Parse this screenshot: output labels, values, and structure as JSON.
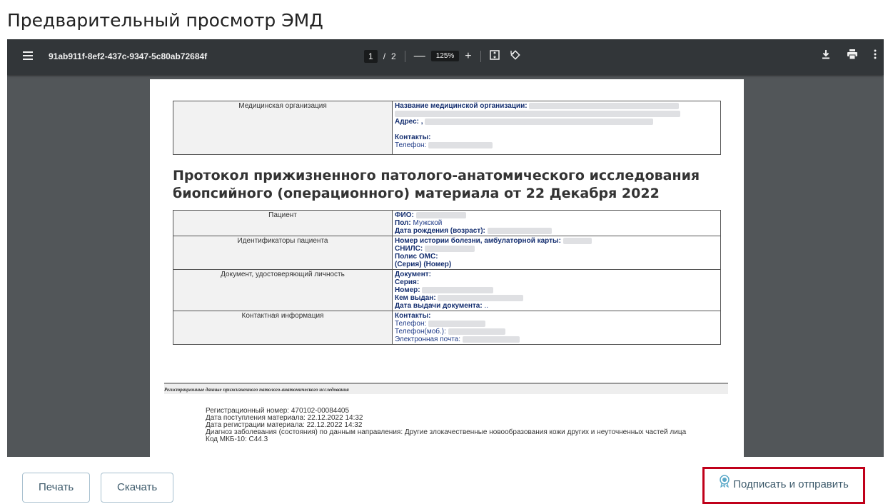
{
  "page_title": "Предварительный просмотр ЭМД",
  "viewer": {
    "file_name": "91ab911f-8ef2-437c-9347-5c80ab72684f",
    "page_current": "1",
    "page_sep": "/",
    "page_total": "2",
    "zoom": "125%",
    "zoom_out": "—",
    "zoom_in": "+"
  },
  "document": {
    "org_label": "Медицинская организация",
    "org_name_label": "Название медицинской организации:",
    "address_label": "Адрес: ,",
    "contacts_label": "Контакты:",
    "phone_label": "Телефон:",
    "title": "Протокол прижизненного патолого-анатомического исследования биопсийного (операционного) материала от 22 Декабря 2022",
    "patient_label": "Пациент",
    "fio_label": "ФИО:",
    "sex_label": "Пол:",
    "sex_value": " Мужской",
    "dob_label": "Дата рождения (возраст):",
    "ids_label": "Идентификаторы пациента",
    "history_label": "Номер истории болезни, амбулаторной карты:",
    "snils_label": "СНИЛС:",
    "oms_label": "Полис ОМС:",
    "oms_value": "(Серия) (Номер)",
    "id_doc_label": "Документ, удостоверяющий личность",
    "doc_label": "Документ:",
    "series_label": "Серия:",
    "number_label": "Номер:",
    "issued_by_label": "Кем выдан:",
    "issue_date_label": "Дата выдачи документа:",
    "issue_date_value": " ..",
    "contact_info_label": "Контактная информация",
    "contacts2_label": "Контакты:",
    "phone2_label": "Телефон:",
    "mobile_label": "Телефон(моб.):",
    "email_label": "Электронная почта:",
    "reg_header": "Регистрационные данные прижизненного патолого-анатомического исследования",
    "reg_lines": [
      "Регистрационный номер: 470102-00084405",
      "Дата поступления материала: 22.12.2022 14:32",
      "Дата регистрации материала: 22.12.2022 14:32",
      "Диагноз заболевания (состояния) по данным направления: Другие злокачественные новообразования кожи других и неуточненных частей лица",
      "Код МКБ-10: С44.3"
    ]
  },
  "buttons": {
    "print": "Печать",
    "download": "Скачать",
    "sign_send": "Подписать и отправить"
  },
  "colors": {
    "highlight": "#c0001a",
    "toolbar": "#323639",
    "viewer_bg": "#525659"
  }
}
